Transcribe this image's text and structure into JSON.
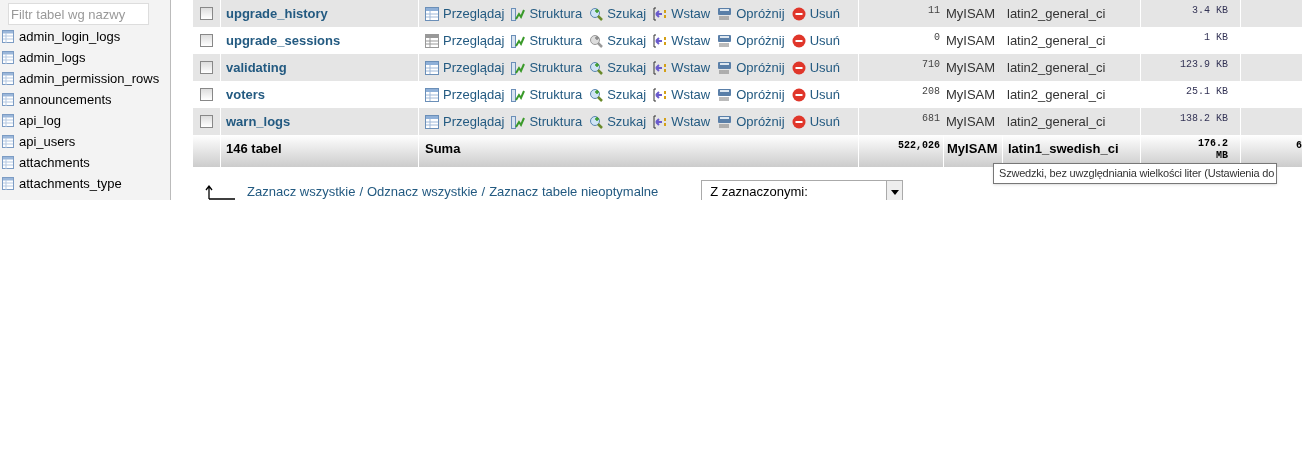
{
  "sidebar": {
    "filter": {
      "placeholder": "Filtr tabel wg nazwy"
    },
    "items": [
      {
        "label": "admin_login_logs"
      },
      {
        "label": "admin_logs"
      },
      {
        "label": "admin_permission_rows"
      },
      {
        "label": "announcements"
      },
      {
        "label": "api_log"
      },
      {
        "label": "api_users"
      },
      {
        "label": "attachments"
      },
      {
        "label": "attachments_type"
      }
    ]
  },
  "table": {
    "rows": [
      {
        "checked": false,
        "empty": false,
        "name": "upgrade_history",
        "actions": [
          {
            "kind": "browse",
            "label": "Przeglądaj"
          },
          {
            "kind": "structure",
            "label": "Struktura"
          },
          {
            "kind": "search",
            "label": "Szukaj"
          },
          {
            "kind": "insert",
            "label": "Wstaw"
          },
          {
            "kind": "empty",
            "label": "Opróżnij"
          },
          {
            "kind": "drop",
            "label": "Usuń"
          }
        ],
        "records": "11",
        "engine": "MyISAM",
        "collation": "latin2_general_ci",
        "size": "3.4 KB"
      },
      {
        "checked": false,
        "empty": true,
        "name": "upgrade_sessions",
        "actions": [
          {
            "kind": "browse",
            "label": "Przeglądaj"
          },
          {
            "kind": "structure",
            "label": "Struktura"
          },
          {
            "kind": "search",
            "label": "Szukaj"
          },
          {
            "kind": "insert",
            "label": "Wstaw"
          },
          {
            "kind": "empty",
            "label": "Opróżnij"
          },
          {
            "kind": "drop",
            "label": "Usuń"
          }
        ],
        "records": "0",
        "engine": "MyISAM",
        "collation": "latin2_general_ci",
        "size": "1 KB"
      },
      {
        "checked": false,
        "empty": false,
        "name": "validating",
        "actions": [
          {
            "kind": "browse",
            "label": "Przeglądaj"
          },
          {
            "kind": "structure",
            "label": "Struktura"
          },
          {
            "kind": "search",
            "label": "Szukaj"
          },
          {
            "kind": "insert",
            "label": "Wstaw"
          },
          {
            "kind": "empty",
            "label": "Opróżnij"
          },
          {
            "kind": "drop",
            "label": "Usuń"
          }
        ],
        "records": "710",
        "engine": "MyISAM",
        "collation": "latin2_general_ci",
        "size": "123.9 KB"
      },
      {
        "checked": false,
        "empty": false,
        "name": "voters",
        "actions": [
          {
            "kind": "browse",
            "label": "Przeglądaj"
          },
          {
            "kind": "structure",
            "label": "Struktura"
          },
          {
            "kind": "search",
            "label": "Szukaj"
          },
          {
            "kind": "insert",
            "label": "Wstaw"
          },
          {
            "kind": "empty",
            "label": "Opróżnij"
          },
          {
            "kind": "drop",
            "label": "Usuń"
          }
        ],
        "records": "208",
        "engine": "MyISAM",
        "collation": "latin2_general_ci",
        "size": "25.1 KB"
      },
      {
        "checked": false,
        "empty": false,
        "name": "warn_logs",
        "actions": [
          {
            "kind": "browse",
            "label": "Przeglądaj"
          },
          {
            "kind": "structure",
            "label": "Struktura"
          },
          {
            "kind": "search",
            "label": "Szukaj"
          },
          {
            "kind": "insert",
            "label": "Wstaw"
          },
          {
            "kind": "empty",
            "label": "Opróżnij"
          },
          {
            "kind": "drop",
            "label": "Usuń"
          }
        ],
        "records": "681",
        "engine": "MyISAM",
        "collation": "latin2_general_ci",
        "size": "138.2 KB"
      }
    ],
    "footer": {
      "count": "146 tabel",
      "label": "Suma",
      "records": "522,026",
      "engine": "MyISAM",
      "collation": "latin1_swedish_ci",
      "size": "176.2 MB",
      "column_9": "6"
    }
  },
  "selection": {
    "links": [
      "Zaznacz wszystkie",
      "Odznacz wszystkie",
      "Zaznacz tabele nieoptymalne"
    ],
    "separator": "/",
    "select": {
      "value": "Z zaznaczonymi:"
    }
  },
  "tooltip": "Szwedzki, bez uwzględniania wielkości liter (Ustawienia do"
}
